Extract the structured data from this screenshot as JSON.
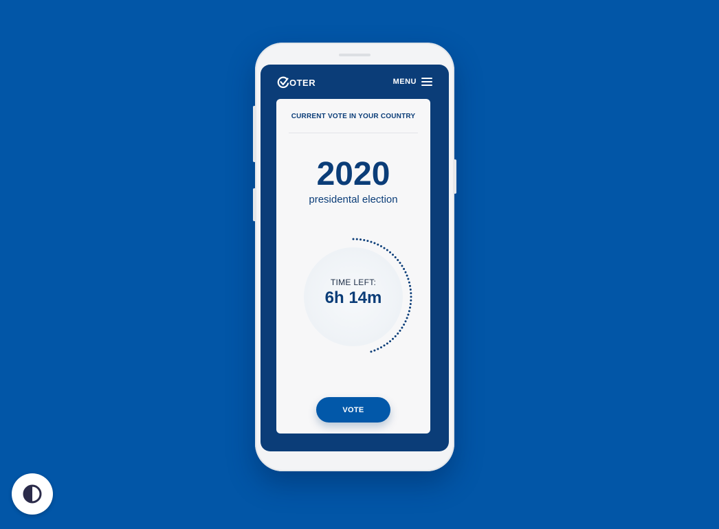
{
  "app": {
    "logo_text": "OTER",
    "menu_label": "MENU"
  },
  "card": {
    "title": "CURRENT VOTE IN YOUR COUNTRY",
    "year": "2020",
    "subtitle": "presidental election",
    "timer": {
      "label": "TIME LEFT:",
      "value": "6h 14m",
      "progress": 0.45
    },
    "vote_label": "VOTE"
  },
  "icons": {
    "logo": "voter-check-logo-icon",
    "menu": "hamburger-icon",
    "accessibility": "contrast-icon"
  },
  "colors": {
    "background": "#0256a7",
    "screen": "#0b3d78",
    "accent": "#0258a9",
    "card": "#f7f7f8"
  }
}
